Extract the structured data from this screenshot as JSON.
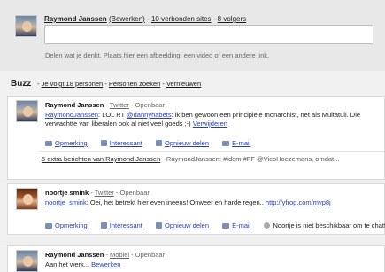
{
  "composer": {
    "name": "Raymond Janssen",
    "edit": "(Bewerken)",
    "sep1": " - ",
    "connected": "10 verbonden sites",
    "sep2": " - ",
    "followers": "8 volgers",
    "hint": "Delen wat je denkt. Plaats hier een afbeelding, een video of een andere link."
  },
  "buzz": {
    "title": "Buzz",
    "follow": "Je volgt 18 personen",
    "search": "Personen zoeken",
    "refresh": "Vernieuwen",
    "dash": " - "
  },
  "posts": [
    {
      "author": "Raymond Janssen",
      "source": "Twitter",
      "visibility": "Openbaar",
      "line1_user": "RaymondJanssen",
      "line1_text": ": LOL RT ",
      "line1_mention": "@dannyhabets",
      "line1_rest": ": ik ben gewoon een principiële monarchist, net als Multatuli. Die",
      "line2_text": "verwachtte van liberalen ook al niet veel goeds ;-) ",
      "line2_link": "Verwijderen",
      "actions": [
        "Opmerking",
        "Interessant",
        "Opnieuw delen",
        "E-mail"
      ],
      "more": "5 extra berichten van Raymond Janssen",
      "more_preview": " - RaymondJanssen: #idem #FF @VicoHoezemans, omdat..."
    },
    {
      "author": "noortje smink",
      "source": "Twitter",
      "visibility": "Openbaar",
      "line1_user": "noortje_smink",
      "line1_text": ": Oei, het betrekt hier even ineens! Onweer en harde regen.. ",
      "line1_link": "http://yfrog.com/myp8j",
      "actions": [
        "Opmerking",
        "Interessant",
        "Opnieuw delen",
        "E-mail"
      ],
      "chat": "Noortje is niet beschikbaar om te chatten"
    },
    {
      "author": "Raymond Janssen",
      "source": "Mobiel",
      "visibility": "Openbaar",
      "line1_text": "Aan het werk... ",
      "line1_link": "Bewerken"
    }
  ]
}
